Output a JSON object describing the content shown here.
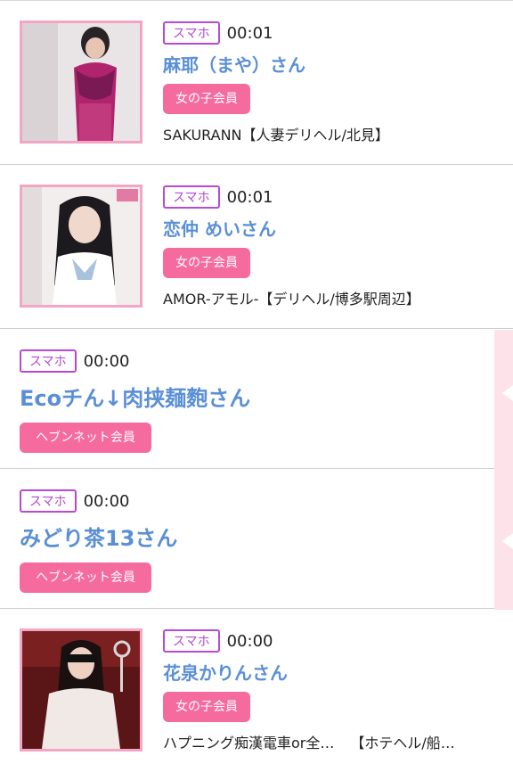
{
  "colors": {
    "device_tag": "#b64ad3",
    "name": "#5a8fd6",
    "badge_bg": "#f56b9e",
    "thumb_border": "#f3a6c4",
    "side_panel": "#fde2ea"
  },
  "entries": [
    {
      "device": "スマホ",
      "time": "00:01",
      "name": "麻耶（まや）さん",
      "badge": "女の子会員",
      "shop": "SAKURANN【人妻デリヘル/北見】",
      "image_icon": "profile-photo"
    },
    {
      "device": "スマホ",
      "time": "00:01",
      "name": "恋仲 めいさん",
      "badge": "女の子会員",
      "shop": "AMOR-アモル-【デリヘル/博多駅周辺】",
      "image_icon": "profile-photo"
    },
    {
      "device": "スマホ",
      "time": "00:00",
      "name": "Ecoチん↓肉挟麺麭さん",
      "badge": "ヘブンネット会員"
    },
    {
      "device": "スマホ",
      "time": "00:00",
      "name": "みどり茶13さん",
      "badge": "ヘブンネット会員"
    },
    {
      "device": "スマホ",
      "time": "00:00",
      "name": "花泉かりんさん",
      "badge": "女の子会員",
      "shop_part1": "ハプニング痴漢電車or全…",
      "shop_part2": "【ホテヘル/船…",
      "image_icon": "profile-photo"
    }
  ]
}
